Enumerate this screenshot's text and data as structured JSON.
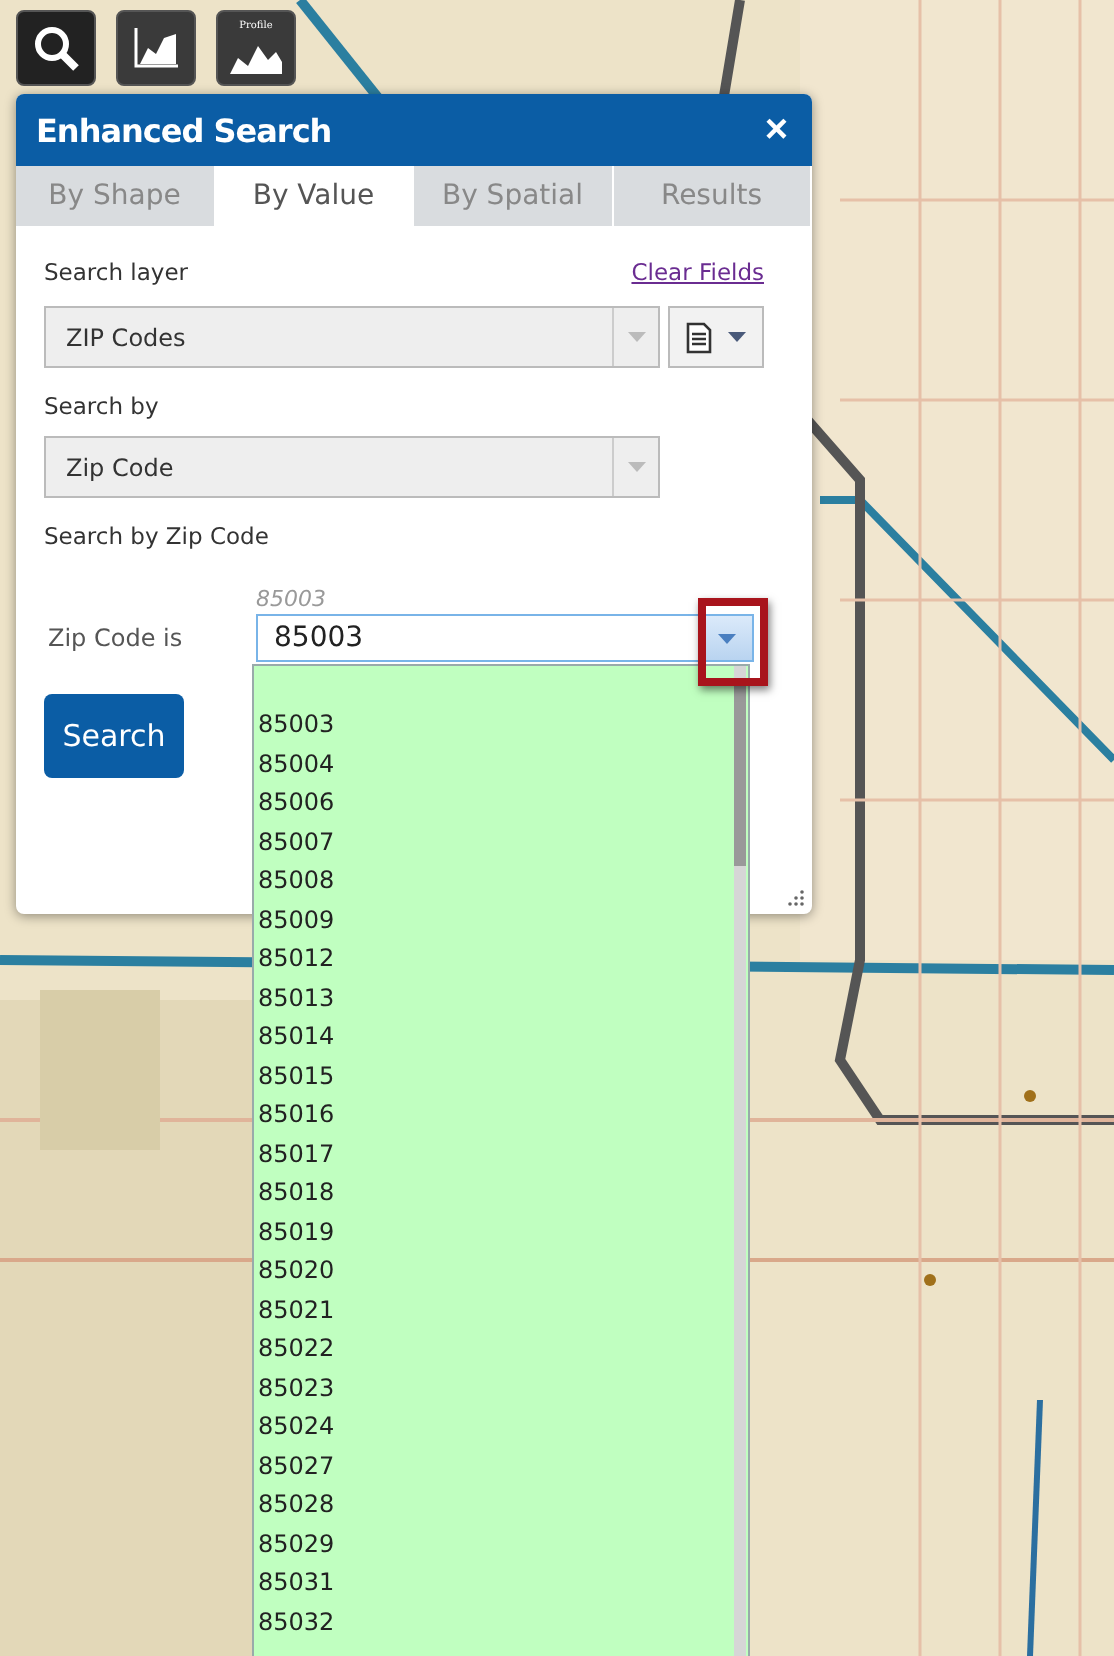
{
  "toolbar": [
    {
      "kind": "search"
    },
    {
      "kind": "chart"
    },
    {
      "kind": "profile",
      "label": "Profile"
    }
  ],
  "panel": {
    "title": "Enhanced Search",
    "close": "×",
    "tabs": [
      {
        "label": "By Shape",
        "selected": false
      },
      {
        "label": "By Value",
        "selected": true
      },
      {
        "label": "By Spatial",
        "selected": false
      },
      {
        "label": "Results",
        "selected": false
      }
    ],
    "search_layer": {
      "label": "Search layer",
      "link": "Clear Fields",
      "value": "ZIP Codes"
    },
    "search_by": {
      "label": "Search by",
      "value": "Zip Code"
    },
    "section_title": "Search by Zip Code",
    "zip_field": {
      "label": "Zip Code is",
      "hint": "85003",
      "value": "85003",
      "expanded": true,
      "highlighted": true
    },
    "search_button": "Search"
  },
  "dropdown": {
    "items": [
      "85003",
      "85004",
      "85006",
      "85007",
      "85008",
      "85009",
      "85012",
      "85013",
      "85014",
      "85015",
      "85016",
      "85017",
      "85018",
      "85019",
      "85020",
      "85021",
      "85022",
      "85023",
      "85024",
      "85027",
      "85028",
      "85029",
      "85031",
      "85032"
    ]
  }
}
